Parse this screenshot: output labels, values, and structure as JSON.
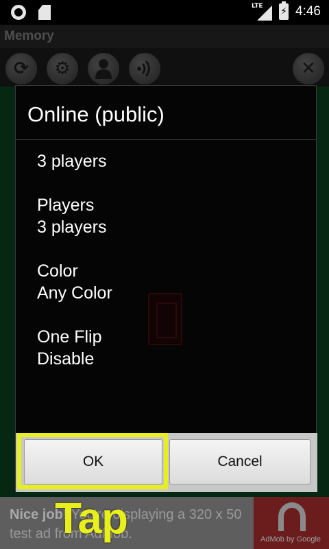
{
  "status_bar": {
    "network": "LTE",
    "battery_glyph": "⚡",
    "time": "4:46"
  },
  "app": {
    "title": "Memory"
  },
  "toolbar": {
    "buttons": [
      {
        "icon": "refresh-icon"
      },
      {
        "icon": "gear-icon"
      },
      {
        "icon": "person-icon"
      },
      {
        "icon": "sound-icon"
      },
      {
        "icon": "close-icon"
      }
    ]
  },
  "dialog": {
    "title": "Online (public)",
    "summary": "3 players",
    "options": [
      {
        "label": "Players",
        "value": "3 players"
      },
      {
        "label": "Color",
        "value": "Any Color"
      },
      {
        "label": "One Flip",
        "value": "Disable"
      }
    ],
    "ok_label": "OK",
    "cancel_label": "Cancel"
  },
  "ad": {
    "headline": "Nice job!",
    "body": " You're displaying a 320 x 50 test ad from AdMob.",
    "logo_caption": "AdMob by Google"
  },
  "overlay": {
    "tap_label": "Tap",
    "highlight_color": "#e8ef1c"
  }
}
